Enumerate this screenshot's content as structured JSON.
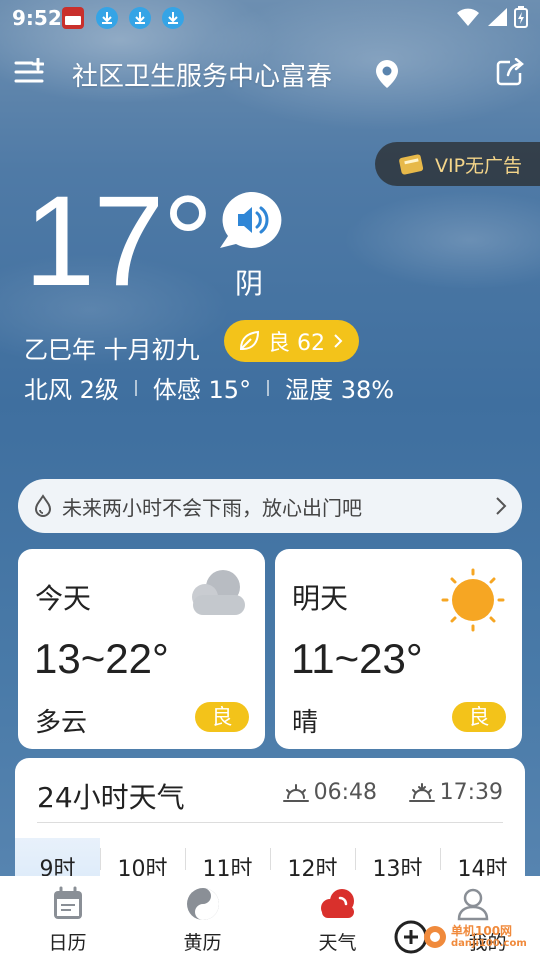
{
  "status_bar": {
    "time": "9:52"
  },
  "header": {
    "location": "社区卫生服务中心富春"
  },
  "vip": {
    "label": "VIP无广告"
  },
  "current": {
    "temperature": "17°",
    "condition": "阴",
    "lunar_date": "乙巳年 十月初九",
    "aqi_label": "良 62",
    "wind": "北风 2级",
    "feels_like": "体感 15°",
    "humidity": "湿度 38%"
  },
  "rain_notice": "未来两小时不会下雨，放心出门吧",
  "forecast": {
    "today": {
      "label": "今天",
      "range": "13~22°",
      "condition": "多云",
      "aqi": "良",
      "icon": "cloud-icon"
    },
    "tomorrow": {
      "label": "明天",
      "range": "11~23°",
      "condition": "晴",
      "aqi": "良",
      "icon": "sun-icon"
    }
  },
  "hourly": {
    "title": "24小时天气",
    "sunrise": "06:48",
    "sunset": "17:39",
    "hours": [
      "9时",
      "10时",
      "11时",
      "12时",
      "13时",
      "14时"
    ]
  },
  "nav": {
    "items": [
      {
        "label": "日历",
        "icon": "calendar-icon"
      },
      {
        "label": "黄历",
        "icon": "yin-yang-icon"
      },
      {
        "label": "天气",
        "icon": "weather-icon"
      },
      {
        "label": "我的",
        "icon": "profile-icon"
      }
    ]
  },
  "watermark": {
    "line1": "单机100网",
    "line2": "danji100.com"
  },
  "colors": {
    "aqi": "#f3c31a",
    "accent_red": "#d9302c",
    "vip_text": "#f4d58a"
  }
}
